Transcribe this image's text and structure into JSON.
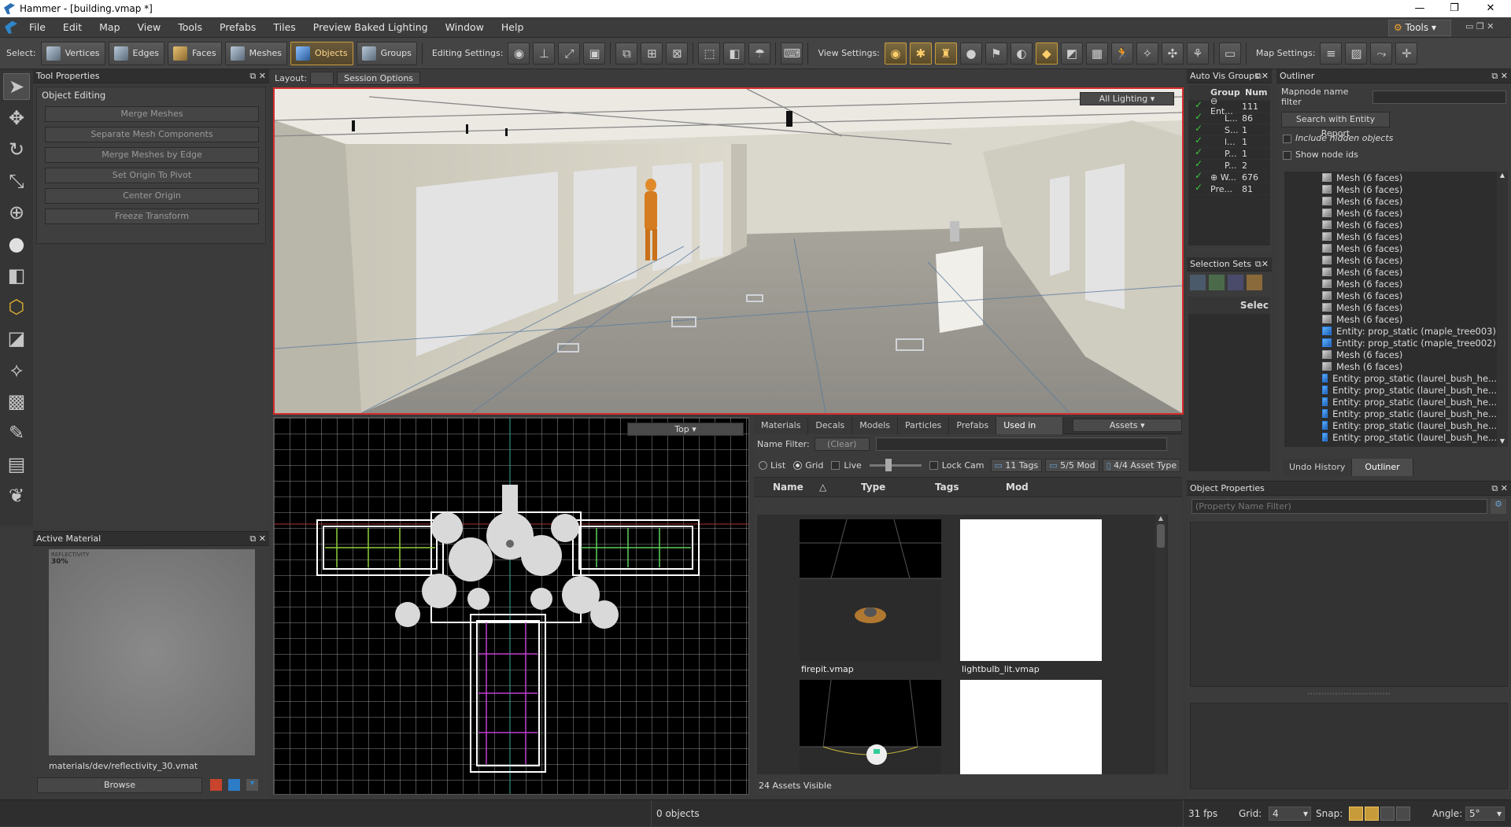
{
  "window": {
    "title": "Hammer - [building.vmap *]",
    "controls": [
      "—",
      "❐",
      "✕"
    ]
  },
  "menu": {
    "items": [
      "File",
      "Edit",
      "Map",
      "View",
      "Tools",
      "Prefabs",
      "Tiles",
      "Preview Baked Lighting",
      "Window",
      "Help"
    ],
    "tools_label": "Tools"
  },
  "toolbar": {
    "select_label": "Select:",
    "select_modes": [
      "Vertices",
      "Edges",
      "Faces",
      "Meshes",
      "Objects",
      "Groups"
    ],
    "active_mode": "Objects",
    "editing_label": "Editing Settings:",
    "view_label": "View Settings:",
    "map_label": "Map Settings:"
  },
  "tool_properties": {
    "title": "Tool Properties",
    "section": "Object Editing",
    "buttons": [
      "Merge Meshes",
      "Separate Mesh Components",
      "Merge Meshes by Edge",
      "Set Origin To Pivot",
      "Center Origin",
      "Freeze Transform"
    ]
  },
  "active_material": {
    "title": "Active Material",
    "preview_text": "REFLECTIVITY",
    "preview_value": "30%",
    "path": "materials/dev/reflectivity_30.vmat",
    "browse_label": "Browse"
  },
  "layout": {
    "label": "Layout:",
    "session_options": "Session Options"
  },
  "viewport3d": {
    "lighting_mode": "All Lighting"
  },
  "viewport2d": {
    "view_mode": "Top"
  },
  "asset_browser": {
    "tabs": [
      "Materials",
      "Decals",
      "Models",
      "Particles",
      "Prefabs",
      "Used in Map"
    ],
    "active_tab": "Used in Map",
    "assets_dropdown": "Assets",
    "name_filter_label": "Name Filter:",
    "clear_label": "(Clear)",
    "list_label": "List",
    "grid_label": "Grid",
    "live_label": "Live",
    "lock_cam_label": "Lock Cam",
    "tags_btn": "11 Tags",
    "mods_btn": "5/5 Mod",
    "types_btn": "4/4 Asset Type",
    "columns": [
      "Name",
      "Type",
      "Tags",
      "Mod"
    ],
    "items": [
      "firepit.vmap",
      "lightbulb_lit.vmap"
    ],
    "status": "24 Assets Visible"
  },
  "auto_vis": {
    "title": "Auto Vis Groups",
    "col_group": "Group",
    "col_num": "Num",
    "rows": [
      {
        "group": "⊖ Ent...",
        "num": "111"
      },
      {
        "group": "L...",
        "num": "86"
      },
      {
        "group": "S...",
        "num": "1"
      },
      {
        "group": "l...",
        "num": "1"
      },
      {
        "group": "P...",
        "num": "1"
      },
      {
        "group": "P...",
        "num": "2"
      },
      {
        "group": "⊕ W...",
        "num": "676"
      },
      {
        "group": "Pre...",
        "num": "81"
      }
    ]
  },
  "selection_sets": {
    "title": "Selection Sets",
    "col": "Selec"
  },
  "outliner": {
    "title": "Outliner",
    "filter_label": "Mapnode name filter",
    "search_btn": "Search with Entity Report",
    "include_hidden": "Include hidden objects",
    "show_ids": "Show node ids",
    "items": [
      {
        "label": "Mesh (6 faces)",
        "entity": false
      },
      {
        "label": "Mesh (6 faces)",
        "entity": false
      },
      {
        "label": "Mesh (6 faces)",
        "entity": false
      },
      {
        "label": "Mesh (6 faces)",
        "entity": false
      },
      {
        "label": "Mesh (6 faces)",
        "entity": false
      },
      {
        "label": "Mesh (6 faces)",
        "entity": false
      },
      {
        "label": "Mesh (6 faces)",
        "entity": false
      },
      {
        "label": "Mesh (6 faces)",
        "entity": false
      },
      {
        "label": "Mesh (6 faces)",
        "entity": false
      },
      {
        "label": "Mesh (6 faces)",
        "entity": false
      },
      {
        "label": "Mesh (6 faces)",
        "entity": false
      },
      {
        "label": "Mesh (6 faces)",
        "entity": false
      },
      {
        "label": "Mesh (6 faces)",
        "entity": false
      },
      {
        "label": "Entity: prop_static (maple_tree003)",
        "entity": true
      },
      {
        "label": "Entity: prop_static (maple_tree002)",
        "entity": true
      },
      {
        "label": "Mesh (6 faces)",
        "entity": false
      },
      {
        "label": "Mesh (6 faces)",
        "entity": false
      },
      {
        "label": "Entity: prop_static (laurel_bush_he...",
        "entity": true
      },
      {
        "label": "Entity: prop_static (laurel_bush_he...",
        "entity": true
      },
      {
        "label": "Entity: prop_static (laurel_bush_he...",
        "entity": true
      },
      {
        "label": "Entity: prop_static (laurel_bush_he...",
        "entity": true
      },
      {
        "label": "Entity: prop_static (laurel_bush_he...",
        "entity": true
      },
      {
        "label": "Entity: prop_static (laurel_bush_he...",
        "entity": true
      }
    ],
    "tab_undo": "Undo History",
    "tab_outliner": "Outliner"
  },
  "object_properties": {
    "title": "Object Properties",
    "filter_placeholder": "(Property Name Filter)"
  },
  "status": {
    "objects": "0 objects",
    "fps": "31 fps",
    "grid_label": "Grid:",
    "grid_value": "4",
    "snap_label": "Snap:",
    "angle_label": "Angle:",
    "angle_value": "5°"
  },
  "colors": {
    "accent": "#c89b3a",
    "selection_border": "#d52c2c",
    "panel": "#3b3b3b"
  }
}
